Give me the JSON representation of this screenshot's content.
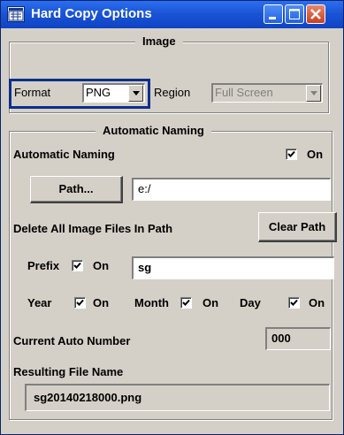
{
  "window": {
    "title": "Hard Copy Options",
    "icon": "window-app-icon"
  },
  "image_group": {
    "title": "Image",
    "format_label": "Format",
    "format_value": "PNG",
    "region_label": "Region",
    "region_value": "Full Screen"
  },
  "naming_group": {
    "title": "Automatic Naming",
    "auto_naming_label": "Automatic Naming",
    "auto_naming_on": "On",
    "path_button": "Path...",
    "path_value": "e:/",
    "delete_label": "Delete All Image Files In Path",
    "clear_path_button": "Clear Path",
    "prefix_label": "Prefix",
    "prefix_on": "On",
    "prefix_value": "sg",
    "year_label": "Year",
    "year_on": "On",
    "month_label": "Month",
    "month_on": "On",
    "day_label": "Day",
    "day_on": "On",
    "auto_number_label": "Current Auto Number",
    "auto_number_value": "000",
    "result_label": "Resulting File Name",
    "result_value": "sg20140218000.png"
  },
  "colors": {
    "titlebar": "#1a55d6",
    "face": "#d4d0c8",
    "focus": "#0b2f8a"
  }
}
